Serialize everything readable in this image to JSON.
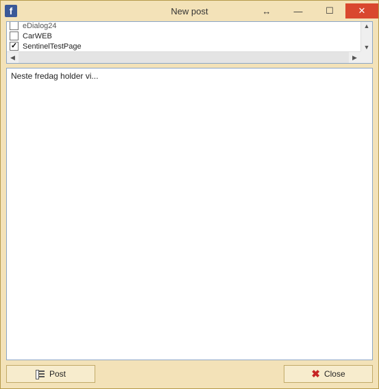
{
  "window": {
    "title": "New post"
  },
  "pages": {
    "items": [
      {
        "label": "eDialog24",
        "checked": false,
        "cutoff": true
      },
      {
        "label": "CarWEB",
        "checked": false,
        "cutoff": false
      },
      {
        "label": "SentinelTestPage",
        "checked": true,
        "cutoff": false
      }
    ]
  },
  "compose": {
    "text": "Neste fredag holder vi..."
  },
  "buttons": {
    "post": "Post",
    "close": "Close"
  }
}
